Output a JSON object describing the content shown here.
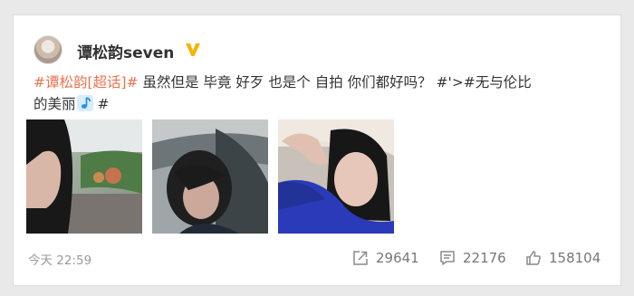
{
  "post": {
    "username": "谭松韵seven",
    "text": {
      "topic1": "#谭松韵[超话]#",
      "body": " 虽然但是 毕竟 好歹 也是个 自拍 你们都好吗？ #'>#无与伦比",
      "line2": "的美丽",
      "topic_end": "#"
    },
    "timestamp": "今天 22:59",
    "stats": {
      "reposts": "29641",
      "comments": "22176",
      "likes": "158104"
    }
  },
  "icons": {
    "verified": "verified-badge-icon",
    "music_note": "music-note-icon",
    "repost": "repost-icon",
    "comment": "comment-icon",
    "like": "thumbs-up-icon"
  },
  "colors": {
    "topic": "#eb7350",
    "verified": "#f5b400",
    "timestamp": "#9a9a9a",
    "background": "#e9e9e9"
  }
}
